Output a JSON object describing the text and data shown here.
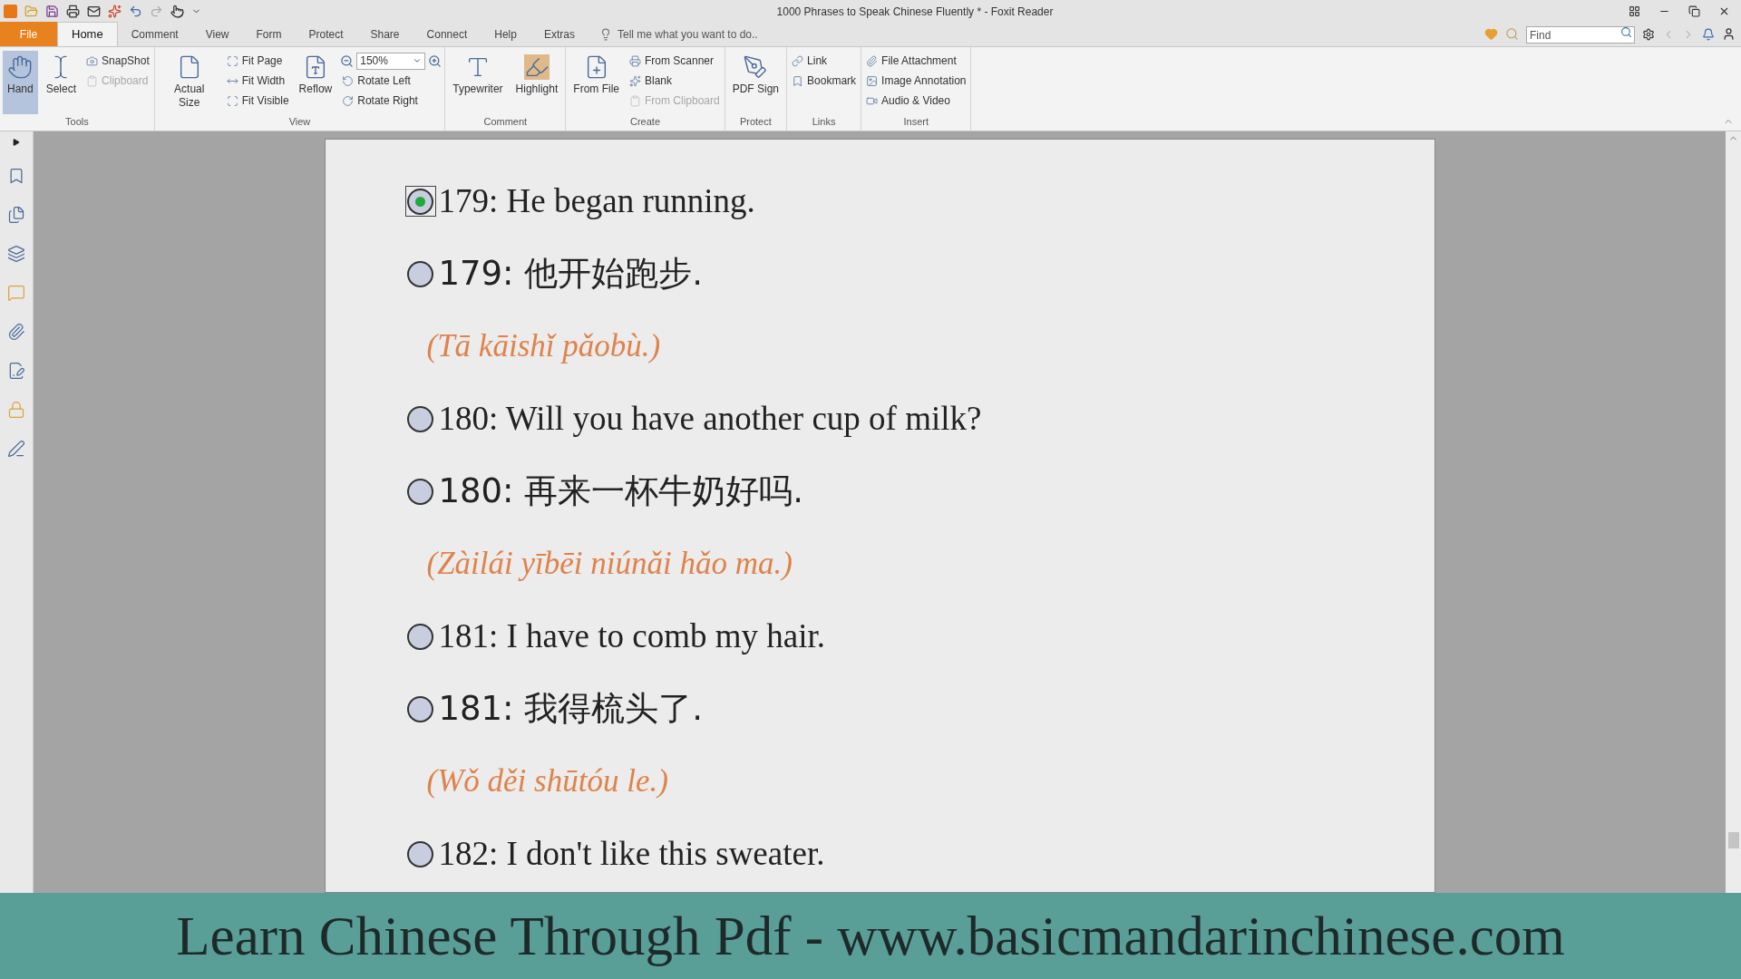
{
  "window": {
    "title": "1000 Phrases to Speak Chinese Fluently * - Foxit Reader"
  },
  "menu_tabs": [
    {
      "label": "File",
      "kind": "file",
      "selected": false
    },
    {
      "label": "Home",
      "kind": "tab",
      "selected": true
    },
    {
      "label": "Comment",
      "kind": "tab",
      "selected": false
    },
    {
      "label": "View",
      "kind": "tab",
      "selected": false
    },
    {
      "label": "Form",
      "kind": "tab",
      "selected": false
    },
    {
      "label": "Protect",
      "kind": "tab",
      "selected": false
    },
    {
      "label": "Share",
      "kind": "tab",
      "selected": false
    },
    {
      "label": "Connect",
      "kind": "tab",
      "selected": false
    },
    {
      "label": "Help",
      "kind": "tab",
      "selected": false
    },
    {
      "label": "Extras",
      "kind": "tab",
      "selected": false
    }
  ],
  "tell_me": {
    "placeholder": "Tell me what you want to do.."
  },
  "find": {
    "placeholder": "Find"
  },
  "ribbon_groups": [
    {
      "label": "Tools",
      "columns": [
        [
          {
            "kind": "large",
            "label": "Hand",
            "selected": true
          }
        ],
        [
          {
            "kind": "large",
            "label": "Select",
            "selected": false
          }
        ],
        [
          {
            "kind": "small",
            "label": "SnapShot",
            "disabled": false
          },
          {
            "kind": "small",
            "label": "Clipboard",
            "disabled": true
          }
        ]
      ]
    },
    {
      "label": "View",
      "columns": [
        [
          {
            "kind": "large",
            "label": "Actual Size",
            "selected": false
          }
        ],
        [
          {
            "kind": "small",
            "label": "Fit Page",
            "disabled": false
          },
          {
            "kind": "small",
            "label": "Fit Width",
            "disabled": false
          },
          {
            "kind": "small",
            "label": "Fit Visible",
            "disabled": false
          }
        ],
        [
          {
            "kind": "large",
            "label": "Reflow",
            "selected": false
          }
        ],
        [
          {
            "kind": "combo",
            "label": "150%"
          },
          {
            "kind": "small",
            "label": "Rotate Left",
            "disabled": false
          },
          {
            "kind": "small",
            "label": "Rotate Right",
            "disabled": false
          }
        ]
      ]
    },
    {
      "label": "Comment",
      "columns": [
        [
          {
            "kind": "large",
            "label": "Typewriter",
            "selected": false
          }
        ],
        [
          {
            "kind": "large",
            "label": "Highlight",
            "selected": false
          }
        ]
      ]
    },
    {
      "label": "Create",
      "columns": [
        [
          {
            "kind": "large",
            "label": "From File",
            "selected": false
          }
        ],
        [
          {
            "kind": "small",
            "label": "From Scanner",
            "disabled": false
          },
          {
            "kind": "small",
            "label": "Blank",
            "disabled": false
          },
          {
            "kind": "small",
            "label": "From Clipboard",
            "disabled": true
          }
        ]
      ]
    },
    {
      "label": "Protect",
      "columns": [
        [
          {
            "kind": "large",
            "label": "PDF Sign",
            "selected": false
          }
        ]
      ]
    },
    {
      "label": "Links",
      "columns": [
        [
          {
            "kind": "small",
            "label": "Link",
            "disabled": false
          },
          {
            "kind": "small",
            "label": "Bookmark",
            "disabled": false
          }
        ]
      ]
    },
    {
      "label": "Insert",
      "columns": [
        [
          {
            "kind": "small",
            "label": "File Attachment",
            "disabled": false
          },
          {
            "kind": "small",
            "label": "Image Annotation",
            "disabled": false
          },
          {
            "kind": "small",
            "label": "Audio & Video",
            "disabled": false
          }
        ]
      ]
    }
  ],
  "document": {
    "entries": [
      {
        "kind": "english",
        "text": "179: He began running.",
        "selected": true
      },
      {
        "kind": "chinese",
        "text": "179: 他开始跑步.",
        "selected": false
      },
      {
        "kind": "pinyin",
        "text": "(Tā kāishǐ pǎobù.)"
      },
      {
        "kind": "english",
        "text": "180: Will you have another cup of milk?",
        "selected": false
      },
      {
        "kind": "chinese",
        "text": "180: 再来一杯牛奶好吗.",
        "selected": false
      },
      {
        "kind": "pinyin",
        "text": "(Zàilái yībēi niúnǎi hǎo ma.)"
      },
      {
        "kind": "english",
        "text": "181: I have to comb my hair.",
        "selected": false
      },
      {
        "kind": "chinese",
        "text": "181: 我得梳头了.",
        "selected": false
      },
      {
        "kind": "pinyin",
        "text": "(Wǒ děi shūtóu le.)"
      },
      {
        "kind": "english",
        "text": "182: I don't like this sweater.",
        "selected": false
      }
    ]
  },
  "banner": {
    "text": "Learn Chinese Through Pdf - www.basicmandarinchinese.com"
  }
}
